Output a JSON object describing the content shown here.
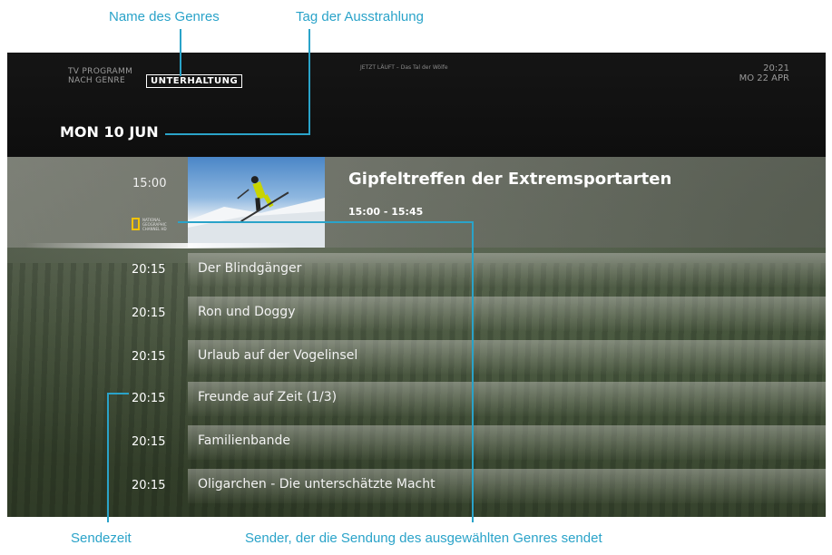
{
  "annotations": {
    "genre_name": "Name des Genres",
    "broadcast_day": "Tag der Ausstrahlung",
    "broadcast_time": "Sendezeit",
    "channel": "Sender, der die Sendung des ausgewählten Genres sendet"
  },
  "header": {
    "line1": "TV PROGRAMM",
    "line2": "NACH GENRE",
    "genre": "UNTERHALTUNG",
    "now_playing": "JETZT LÄUFT – Das Tal der Wölfe",
    "time": "20:21",
    "date": "MO 22 APR",
    "selected_day": "MON 10 JUN"
  },
  "featured": {
    "time": "15:00",
    "title": "Gipfeltreffen der Extremsportarten",
    "range": "15:00 - 15:45",
    "channel_logo": "NATIONAL GEOGRAPHIC CHANNEL HD"
  },
  "programs": [
    {
      "time": "20:15",
      "title": "Der Blindgänger"
    },
    {
      "time": "20:15",
      "title": "Ron und Doggy"
    },
    {
      "time": "20:15",
      "title": "Urlaub auf der Vogelinsel"
    },
    {
      "time": "20:15",
      "title": "Freunde auf Zeit (1/3)"
    },
    {
      "time": "20:15",
      "title": "Familienbande"
    },
    {
      "time": "20:15",
      "title": "Oligarchen - Die unterschätzte Macht"
    }
  ],
  "colors": {
    "annotation": "#2aa3c9",
    "logo_yellow": "#f2c200"
  }
}
